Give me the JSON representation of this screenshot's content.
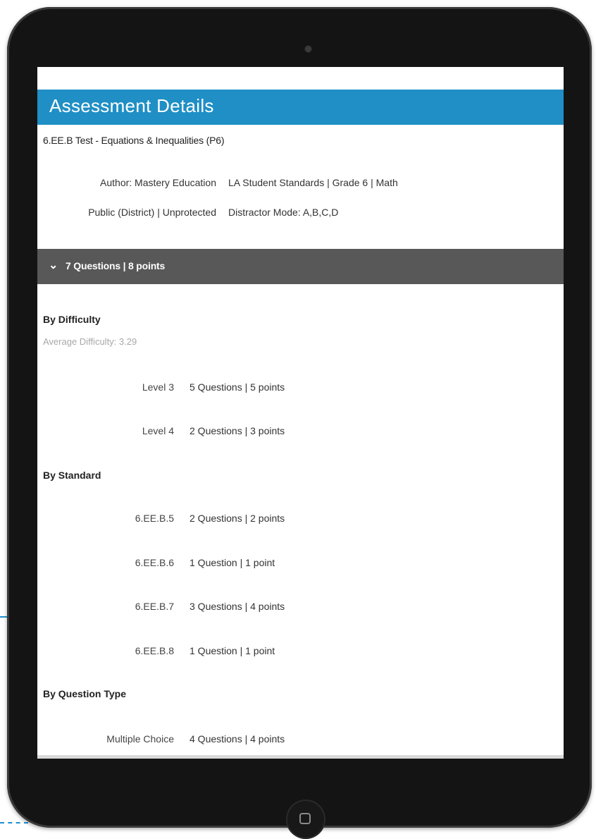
{
  "header": {
    "title": "Assessment Details"
  },
  "assessment": {
    "title": "6.EE.B Test - Equations & Inequalities (P6)",
    "author": "Author: Mastery Education",
    "standards": "LA Student Standards | Grade 6 | Math",
    "visibility": "Public (District) | Unprotected",
    "distractor_mode": "Distractor Mode: A,B,C,D"
  },
  "summary": {
    "chevron": "chevron-down-icon",
    "text": "7 Questions | 8 points"
  },
  "difficulty": {
    "heading": "By Difficulty",
    "average": "Average Difficulty: 3.29",
    "rows": [
      {
        "label": "Level 3",
        "value": "5 Questions | 5 points"
      },
      {
        "label": "Level 4",
        "value": "2 Questions | 3 points"
      }
    ]
  },
  "standard": {
    "heading": "By Standard",
    "rows": [
      {
        "label": "6.EE.B.5",
        "value": "2 Questions | 2 points"
      },
      {
        "label": "6.EE.B.6",
        "value": "1 Question | 1 point"
      },
      {
        "label": "6.EE.B.7",
        "value": "3 Questions | 4 points"
      },
      {
        "label": "6.EE.B.8",
        "value": "1 Question | 1 point"
      }
    ]
  },
  "question_type": {
    "heading": "By Question Type",
    "rows": [
      {
        "label": "Multiple Choice",
        "value": "4 Questions | 4 points"
      }
    ]
  },
  "colors": {
    "header_bg": "#1f8fc6",
    "summary_bg": "#585858",
    "device_frame": "#141414"
  }
}
